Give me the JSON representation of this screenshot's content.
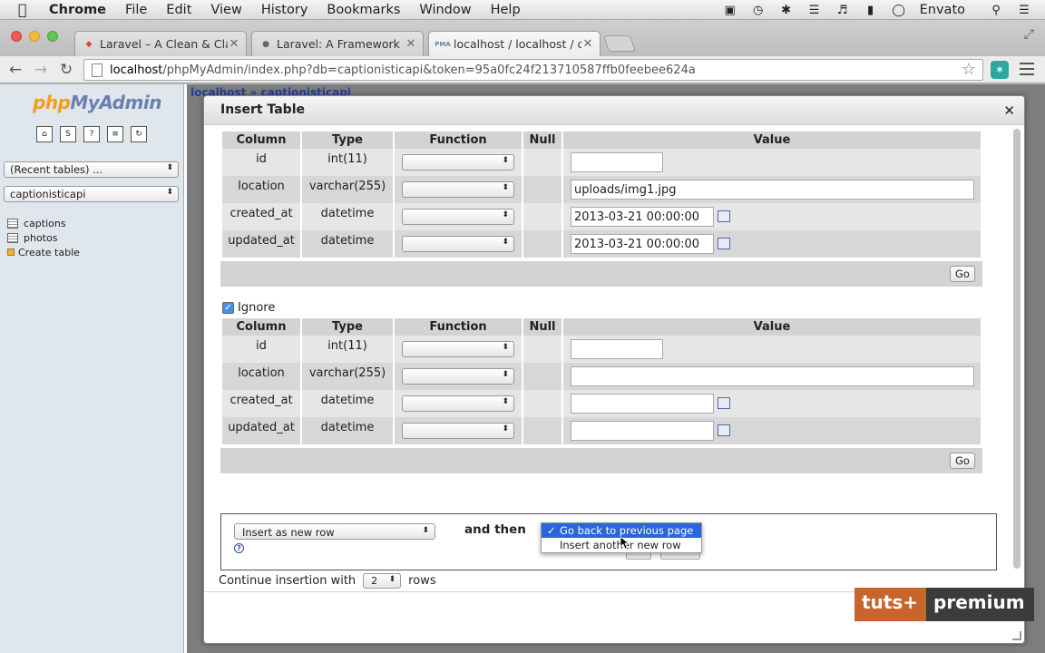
{
  "menubar": {
    "app": "Chrome",
    "items": [
      "File",
      "Edit",
      "View",
      "History",
      "Bookmarks",
      "Window",
      "Help"
    ],
    "user": "Envato"
  },
  "tabs": [
    {
      "title": "Laravel – A Clean & Classy",
      "favicon": "laravel-icon"
    },
    {
      "title": "Laravel: A Framework For",
      "favicon": "globe-icon"
    },
    {
      "title": "localhost / localhost / cap",
      "favicon": "pma-icon",
      "favicon_label": "PMA"
    }
  ],
  "address": {
    "host": "localhost",
    "path": "/phpMyAdmin/index.php?db=captionisticapi&token=95a0fc24f213710587ffb0feebee624a"
  },
  "sidebar": {
    "logo_a": "php",
    "logo_b": "MyAdmin",
    "recent_tables": "(Recent tables) ...",
    "database": "captionisticapi",
    "tables": [
      "captions",
      "photos"
    ],
    "create_table": "Create table"
  },
  "breadcrumb": {
    "server": "localhost",
    "db": "captionisticapi"
  },
  "dialog": {
    "title": "Insert Table",
    "headers": [
      "Column",
      "Type",
      "Function",
      "Null",
      "Value"
    ],
    "rows1": [
      {
        "column": "id",
        "type": "int(11)",
        "value": ""
      },
      {
        "column": "location",
        "type": "varchar(255)",
        "value": "uploads/img1.jpg"
      },
      {
        "column": "created_at",
        "type": "datetime",
        "value": "2013-03-21 00:00:00"
      },
      {
        "column": "updated_at",
        "type": "datetime",
        "value": "2013-03-21 00:00:00"
      }
    ],
    "go_label": "Go",
    "ignore_label": "Ignore",
    "rows2": [
      {
        "column": "id",
        "type": "int(11)"
      },
      {
        "column": "location",
        "type": "varchar(255)"
      },
      {
        "column": "created_at",
        "type": "datetime"
      },
      {
        "column": "updated_at",
        "type": "datetime"
      }
    ],
    "insert_mode": "Insert as new row",
    "and_then": "and then",
    "after_options": [
      "Go back to previous page",
      "Insert another new row"
    ],
    "continue_label": "Continue insertion with",
    "continue_rows": "2",
    "rows_label": "rows"
  },
  "watermark": {
    "a": "tuts+",
    "b": "premium"
  },
  "colors": {
    "accent": "#2966d8",
    "tuts_orange": "#c8642c"
  }
}
